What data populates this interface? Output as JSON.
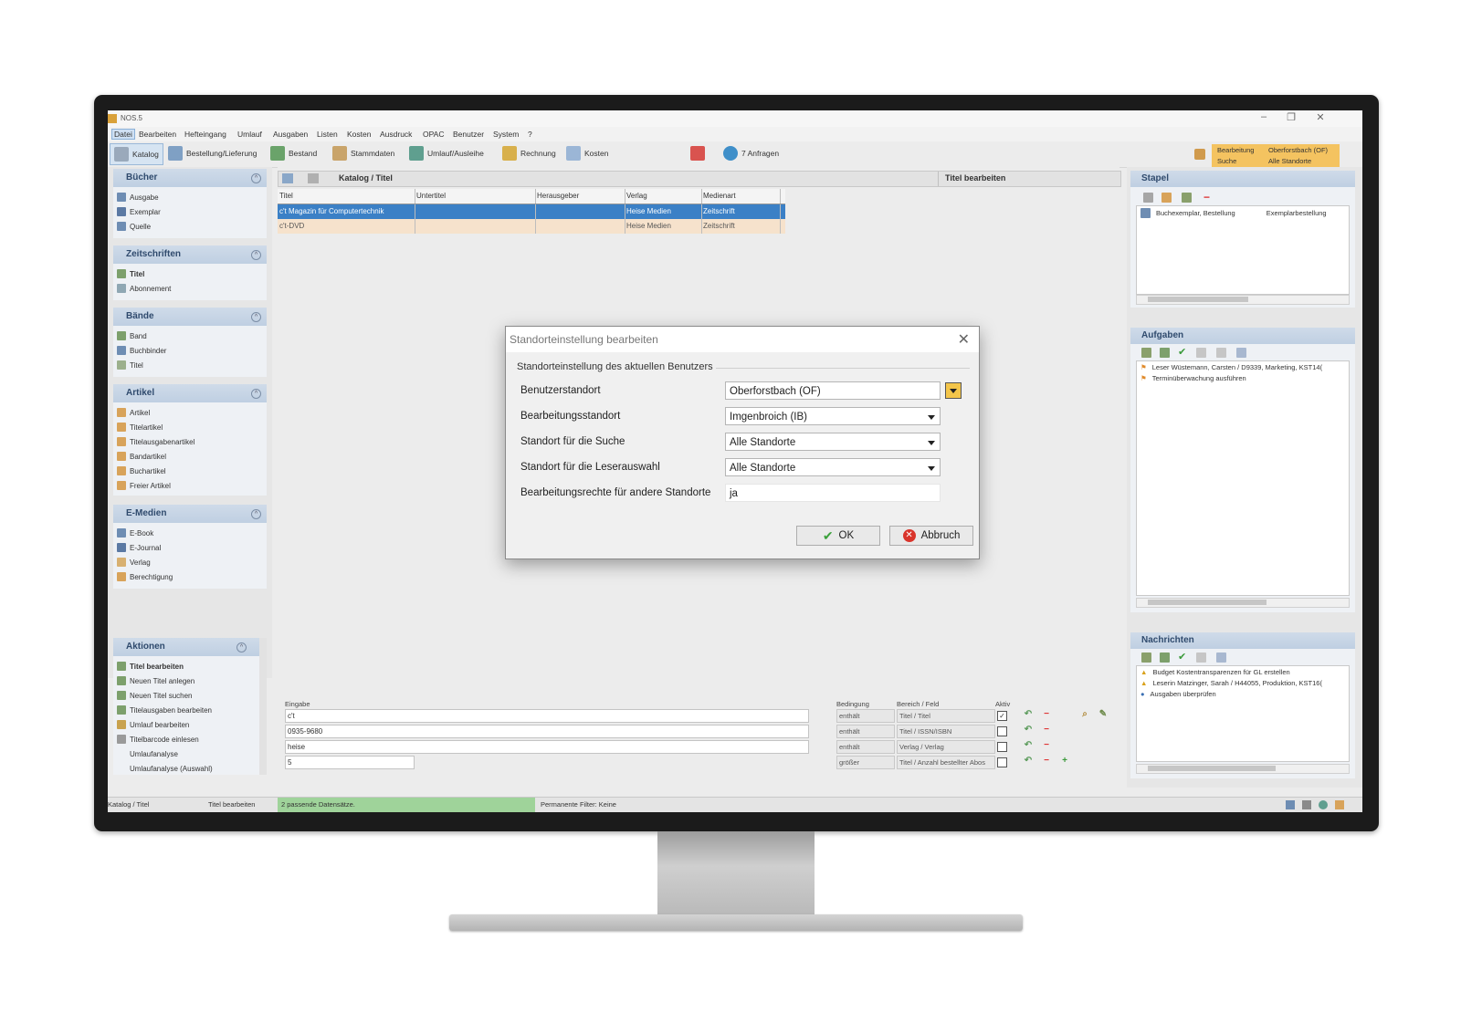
{
  "app": {
    "title": "NOS.5",
    "menu": [
      "Datei",
      "Bearbeiten",
      "Hefteingang",
      "Umlauf",
      "Ausgaben",
      "Listen",
      "Kosten",
      "Ausdruck",
      "OPAC",
      "Benutzer",
      "System",
      "?"
    ],
    "toolbar": {
      "katalog": "Katalog",
      "bestellung": "Bestellung/Lieferung",
      "bestand": "Bestand",
      "stammdaten": "Stammdaten",
      "umlauf": "Umlauf/Ausleihe",
      "rechnung": "Rechnung",
      "kosten": "Kosten",
      "anfragen": "7 Anfragen"
    },
    "location": {
      "bearbeitung_label": "Bearbeitung",
      "bearbeitung_value": "Oberforstbach (OF)",
      "suche_label": "Suche",
      "suche_value": "Alle Standorte"
    }
  },
  "sidebar": {
    "buecher": {
      "title": "Bücher",
      "items": [
        "Ausgabe",
        "Exemplar",
        "Quelle"
      ]
    },
    "zeitschriften": {
      "title": "Zeitschriften",
      "items": [
        "Titel",
        "Abonnement"
      ]
    },
    "baende": {
      "title": "Bände",
      "items": [
        "Band",
        "Buchbinder",
        "Titel"
      ]
    },
    "artikel": {
      "title": "Artikel",
      "items": [
        "Artikel",
        "Titelartikel",
        "Titelausgabenartikel",
        "Bandartikel",
        "Buchartikel",
        "Freier Artikel"
      ]
    },
    "emedien": {
      "title": "E-Medien",
      "items": [
        "E-Book",
        "E-Journal",
        "Verlag",
        "Berechtigung"
      ]
    },
    "aktionen": {
      "title": "Aktionen",
      "items": [
        "Titel bearbeiten",
        "Neuen Titel anlegen",
        "Neuen Titel suchen",
        "Titelausgaben bearbeiten",
        "Umlauf bearbeiten",
        "Titelbarcode einlesen",
        "Umlaufanalyse",
        "Umlaufanalyse (Auswahl)"
      ]
    }
  },
  "main": {
    "breadcrumb": "Katalog / Titel",
    "right_header": "Titel bearbeiten",
    "columns": [
      "Titel",
      "Untertitel",
      "Herausgeber",
      "Verlag",
      "Medienart"
    ],
    "rows": [
      [
        "c't Magazin für Computertechnik",
        "",
        "",
        "Heise Medien",
        "Zeitschrift"
      ],
      [
        "c't-DVD",
        "",
        "",
        "Heise Medien",
        "Zeitschrift"
      ]
    ]
  },
  "filter": {
    "labels": {
      "eingabe": "Eingabe",
      "bedingung": "Bedingung",
      "bereich": "Bereich / Feld",
      "aktiv": "Aktiv"
    },
    "rows": [
      {
        "eingabe": "c't",
        "bedingung": "enthält",
        "feld": "Titel / Titel",
        "aktiv": "✓"
      },
      {
        "eingabe": "0935-9680",
        "bedingung": "enthält",
        "feld": "Titel / ISSN/ISBN",
        "aktiv": ""
      },
      {
        "eingabe": "heise",
        "bedingung": "enthält",
        "feld": "Verlag / Verlag",
        "aktiv": ""
      },
      {
        "eingabe": "5",
        "bedingung": "größer",
        "feld": "Titel / Anzahl bestellter Abos",
        "aktiv": ""
      }
    ]
  },
  "right": {
    "stapel": {
      "title": "Stapel",
      "row": [
        "Buchexemplar, Bestellung",
        "Exemplarbestellung"
      ]
    },
    "aufgaben": {
      "title": "Aufgaben",
      "items": [
        "Leser Wüstemann, Carsten / D9339, Marketing, KST14(",
        "Terminüberwachung ausführen"
      ]
    },
    "nachrichten": {
      "title": "Nachrichten",
      "items": [
        "Budget Kostentransparenzen für GL erstellen",
        "Leserin Matzinger, Sarah / H44055, Produktion, KST16(",
        "Ausgaben überprüfen"
      ]
    }
  },
  "status": {
    "s1": "Katalog / Titel",
    "s2": "Titel bearbeiten",
    "s3": "2 passende Datensätze.",
    "s4": "Permanente Filter: Keine"
  },
  "dialog": {
    "title": "Standorteinstellung bearbeiten",
    "group": "Standorteinstellung des aktuellen Benutzers",
    "fields": [
      {
        "label": "Benutzerstandort",
        "value": "Oberforstbach (OF)"
      },
      {
        "label": "Bearbeitungsstandort",
        "value": "Imgenbroich (IB)"
      },
      {
        "label": "Standort für die Suche",
        "value": "Alle Standorte"
      },
      {
        "label": "Standort für die Leserauswahl",
        "value": "Alle Standorte"
      },
      {
        "label": "Bearbeitungsrechte für andere Standorte",
        "value": "ja"
      }
    ],
    "ok": "OK",
    "cancel": "Abbruch"
  }
}
